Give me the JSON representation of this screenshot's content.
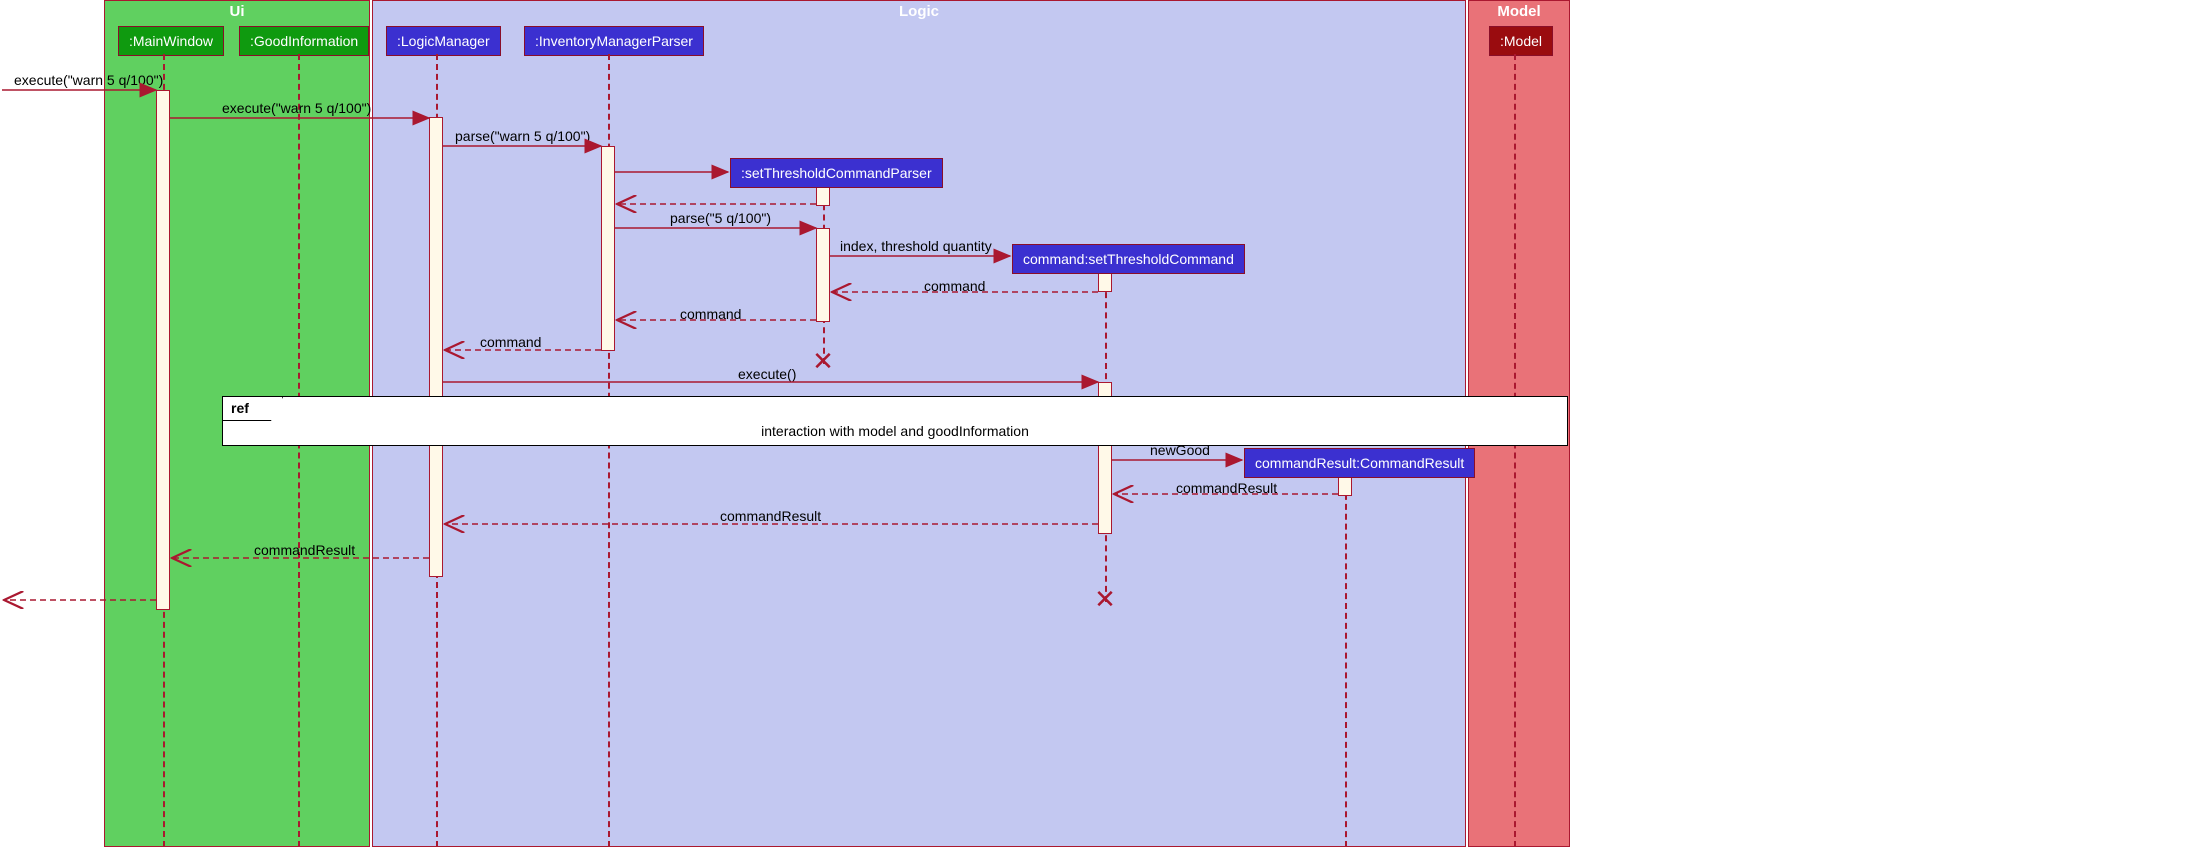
{
  "regions": {
    "ui": "Ui",
    "logic": "Logic",
    "model": "Model"
  },
  "lifelines": {
    "mainWindow": ":MainWindow",
    "goodInformation": ":GoodInformation",
    "logicManager": ":LogicManager",
    "inventoryManagerParser": ":InventoryManagerParser",
    "setThresholdCommandParser": ":setThresholdCommandParser",
    "setThresholdCommand": "command:setThresholdCommand",
    "commandResult": "commandResult:CommandResult",
    "model": ":Model"
  },
  "messages": {
    "m1": "execute(\"warn 5 q/100\")",
    "m2": "execute(\"warn 5 q/100\")",
    "m3": "parse(\"warn 5 q/100\")",
    "m4": "parse(\"5 q/100\")",
    "m5": "index, threshold quantity",
    "r5": "command",
    "r4": "command",
    "r3": "command",
    "m6": "execute()",
    "m7": "newGood",
    "r7": "commandResult",
    "r6": "commandResult",
    "r2": "commandResult"
  },
  "ref": {
    "label": "ref",
    "text": "interaction with model and goodInformation"
  },
  "chart_data": {
    "type": "sequence_diagram",
    "regions": [
      {
        "name": "Ui",
        "lifelines": [
          ":MainWindow",
          ":GoodInformation"
        ]
      },
      {
        "name": "Logic",
        "lifelines": [
          ":LogicManager",
          ":InventoryManagerParser",
          ":setThresholdCommandParser",
          "command:setThresholdCommand",
          "commandResult:CommandResult"
        ]
      },
      {
        "name": "Model",
        "lifelines": [
          ":Model"
        ]
      }
    ],
    "lifelines": [
      ":MainWindow",
      ":GoodInformation",
      ":LogicManager",
      ":InventoryManagerParser",
      ":setThresholdCommandParser",
      "command:setThresholdCommand",
      "commandResult:CommandResult",
      ":Model"
    ],
    "messages": [
      {
        "from": "external",
        "to": ":MainWindow",
        "label": "execute(\"warn 5 q/100\")",
        "type": "sync"
      },
      {
        "from": ":MainWindow",
        "to": ":LogicManager",
        "label": "execute(\"warn 5 q/100\")",
        "type": "sync"
      },
      {
        "from": ":LogicManager",
        "to": ":InventoryManagerParser",
        "label": "parse(\"warn 5 q/100\")",
        "type": "sync"
      },
      {
        "from": ":InventoryManagerParser",
        "to": ":setThresholdCommandParser",
        "label": "",
        "type": "create"
      },
      {
        "from": ":setThresholdCommandParser",
        "to": ":InventoryManagerParser",
        "label": "",
        "type": "return"
      },
      {
        "from": ":InventoryManagerParser",
        "to": ":setThresholdCommandParser",
        "label": "parse(\"5 q/100\")",
        "type": "sync"
      },
      {
        "from": ":setThresholdCommandParser",
        "to": "command:setThresholdCommand",
        "label": "index, threshold quantity",
        "type": "create"
      },
      {
        "from": "command:setThresholdCommand",
        "to": ":setThresholdCommandParser",
        "label": "command",
        "type": "return"
      },
      {
        "from": ":setThresholdCommandParser",
        "to": ":InventoryManagerParser",
        "label": "command",
        "type": "return"
      },
      {
        "from": ":InventoryManagerParser",
        "to": ":LogicManager",
        "label": "command",
        "type": "return"
      },
      {
        "from": ":LogicManager",
        "to": "command:setThresholdCommand",
        "label": "execute()",
        "type": "sync"
      },
      {
        "type": "ref",
        "label": "interaction with model and goodInformation",
        "covers": [
          ":MainWindow",
          ":Model"
        ]
      },
      {
        "from": "command:setThresholdCommand",
        "to": "commandResult:CommandResult",
        "label": "newGood",
        "type": "create"
      },
      {
        "from": "commandResult:CommandResult",
        "to": "command:setThresholdCommand",
        "label": "commandResult",
        "type": "return"
      },
      {
        "from": "command:setThresholdCommand",
        "to": ":LogicManager",
        "label": "commandResult",
        "type": "return"
      },
      {
        "from": ":LogicManager",
        "to": ":MainWindow",
        "label": "commandResult",
        "type": "return"
      },
      {
        "from": ":MainWindow",
        "to": "external",
        "label": "",
        "type": "return"
      },
      {
        "lifeline": ":setThresholdCommandParser",
        "type": "destroy"
      },
      {
        "lifeline": "command:setThresholdCommand",
        "type": "destroy"
      }
    ]
  }
}
